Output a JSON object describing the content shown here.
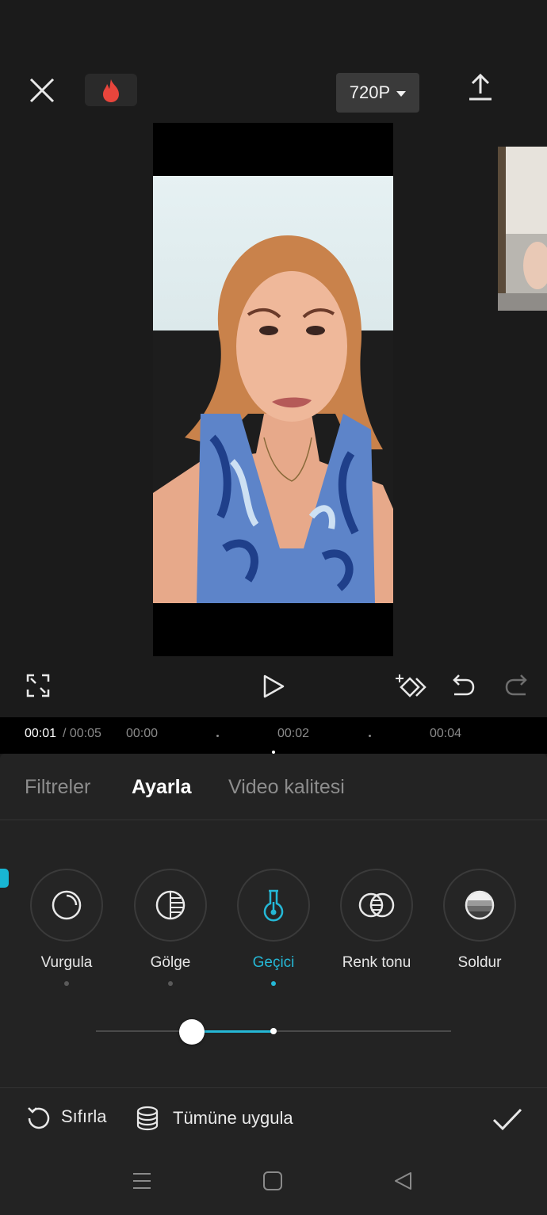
{
  "header": {
    "resolution_label": "720P",
    "close_icon": "close-icon",
    "fire_icon": "fire-icon",
    "export_icon": "export-upload-icon"
  },
  "colors": {
    "accent": "#25b8d6",
    "background": "#1b1b1b",
    "panel": "#232323",
    "fire": "#e8453c"
  },
  "playback": {
    "current_time": "00:01",
    "total_time": "/ 00:05",
    "ticks": [
      "00:00",
      "00:02",
      "00:04"
    ]
  },
  "tabs": [
    {
      "label": "Filtreler",
      "active": false
    },
    {
      "label": "Ayarla",
      "active": true
    },
    {
      "label": "Video kalitesi",
      "active": false
    }
  ],
  "tools": [
    {
      "label": "Vurgula",
      "icon": "highlight-icon",
      "active": false
    },
    {
      "label": "Gölge",
      "icon": "shadow-icon",
      "active": false
    },
    {
      "label": "Geçici",
      "icon": "temperature-icon",
      "active": true
    },
    {
      "label": "Renk tonu",
      "icon": "hue-icon",
      "active": false
    },
    {
      "label": "Soldur",
      "icon": "fade-icon",
      "active": false
    }
  ],
  "slider": {
    "value": 0.27,
    "default": 0.5
  },
  "actions": {
    "reset_label": "Sıfırla",
    "apply_all_label": "Tümüne uygula"
  }
}
